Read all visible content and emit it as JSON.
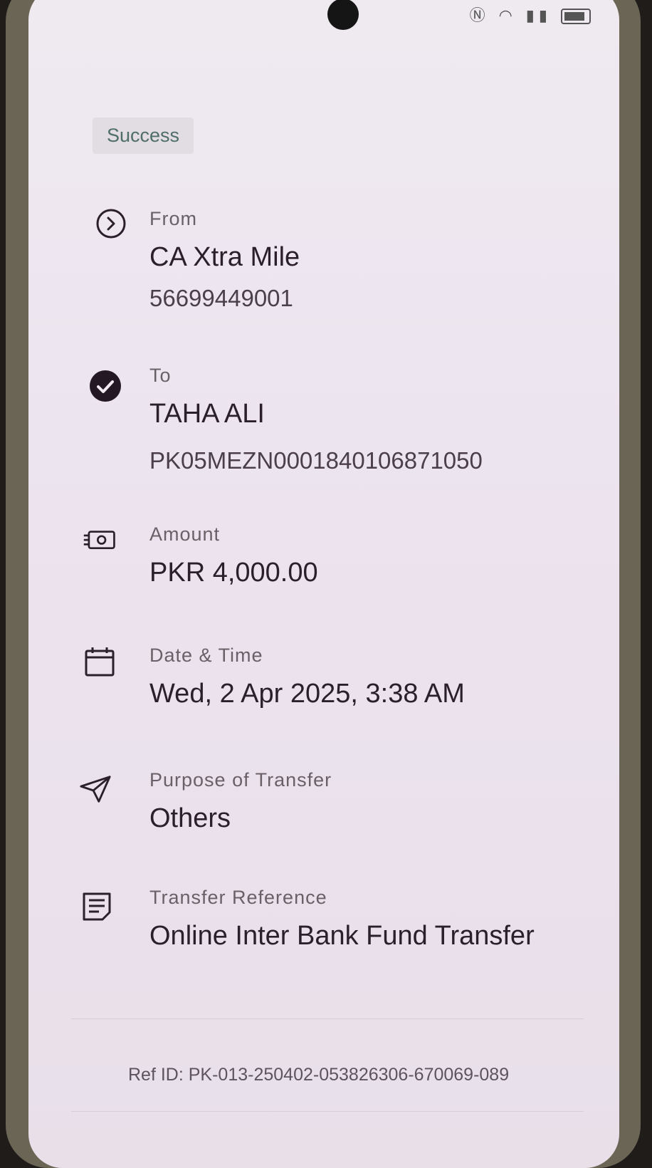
{
  "status": {
    "badge": "Success"
  },
  "details": {
    "from": {
      "label": "From",
      "name": "CA Xtra Mile",
      "account": "56699449001"
    },
    "to": {
      "label": "To",
      "name": "TAHA ALI",
      "iban": "PK05MEZN0001840106871050"
    },
    "amount": {
      "label": "Amount",
      "value": "PKR 4,000.00"
    },
    "datetime": {
      "label": "Date & Time",
      "value": "Wed, 2 Apr 2025, 3:38 AM"
    },
    "purpose": {
      "label": "Purpose of Transfer",
      "value": "Others"
    },
    "reference": {
      "label": "Transfer Reference",
      "value": "Online Inter Bank Fund Transfer"
    }
  },
  "footer": {
    "ref_id": "Ref ID: PK-013-250402-053826306-670069-089"
  },
  "icons": {
    "from": "chevron-circle-icon",
    "to": "check-circle-icon",
    "amount": "cash-icon",
    "datetime": "calendar-icon",
    "purpose": "send-icon",
    "reference": "document-icon"
  },
  "colors": {
    "badge_text": "#4f6e6a",
    "badge_bg": "#e2dde3",
    "text_dark": "#2a1f2b"
  }
}
